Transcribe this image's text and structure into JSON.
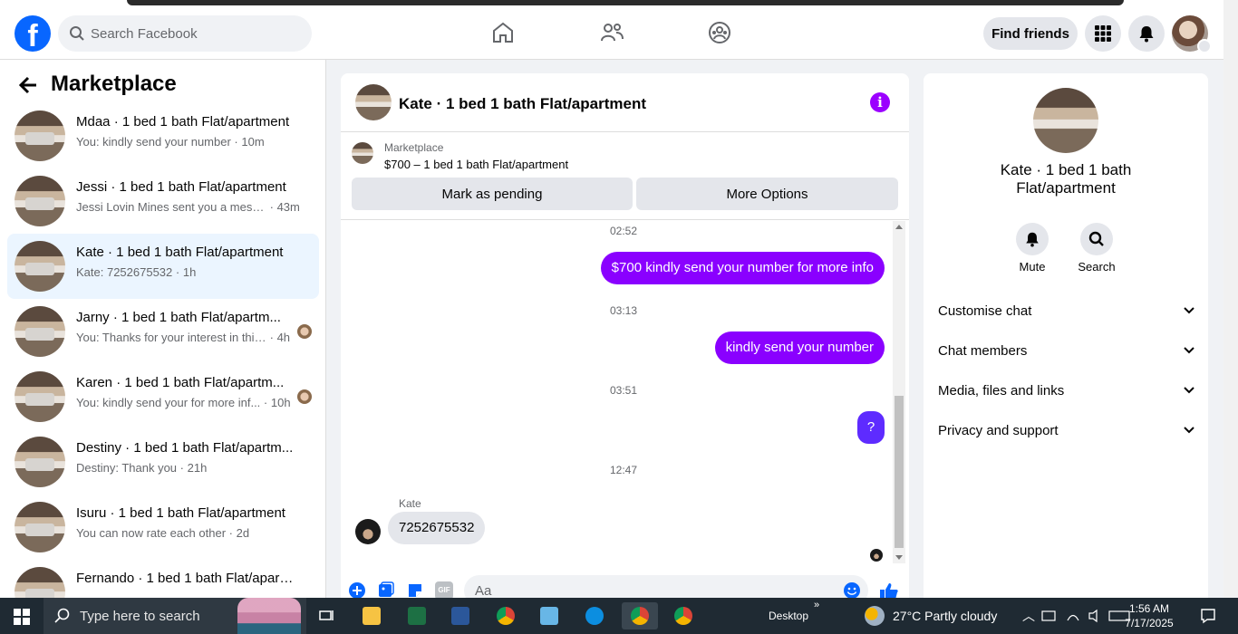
{
  "header": {
    "logo": "f",
    "search_placeholder": "Search Facebook",
    "find_friends_label": "Find friends",
    "nav_icons": [
      "home-icon",
      "friends-icon",
      "groups-icon"
    ],
    "right_icons": [
      "menu-grid-icon",
      "bell-icon",
      "profile-avatar"
    ]
  },
  "sidebar": {
    "title": "Marketplace",
    "conversations": [
      {
        "title": "Mdaa · 1 bed 1 bath Flat/apartment",
        "preview": "You: kindly send your number",
        "time": "10m",
        "active": false
      },
      {
        "title": "Jessi · 1 bed 1 bath Flat/apartment",
        "preview": "Jessi Lovin Mines sent you a messag...",
        "time": "43m",
        "active": false
      },
      {
        "title": "Kate · 1 bed 1 bath Flat/apartment",
        "preview": "Kate: 7252675532",
        "time": "1h",
        "active": true
      },
      {
        "title": "Jarny · 1 bed 1 bath Flat/apartm...",
        "preview": "You: Thanks for your interest in this...",
        "time": "4h",
        "active": false
      },
      {
        "title": "Karen · 1 bed 1 bath Flat/apartm...",
        "preview": "You: kindly send your for more inf...",
        "time": "10h",
        "active": false
      },
      {
        "title": "Destiny · 1 bed 1 bath Flat/apartm...",
        "preview": "Destiny: Thank you",
        "time": "21h",
        "active": false
      },
      {
        "title": "Isuru · 1 bed 1 bath Flat/apartment",
        "preview": "You can now rate each other",
        "time": "2d",
        "active": false
      },
      {
        "title": "Fernando · 1 bed 1 bath Flat/apart...",
        "preview": "",
        "time": "",
        "active": false
      }
    ]
  },
  "chat": {
    "title": "Kate · 1 bed 1 bath Flat/apartment",
    "info_icon": "i",
    "marketplace_label": "Marketplace",
    "listing": "$700 – 1 bed 1 bath Flat/apartment",
    "mark_pending_label": "Mark as pending",
    "more_options_label": "More Options",
    "messages": {
      "t1": "02:52",
      "m1": "$700 kindly send your number for more info",
      "t2": "03:13",
      "m2": "kindly send your number",
      "t3": "03:51",
      "m3": "?",
      "t4": "12:47",
      "sender": "Kate",
      "m4": "7252675532"
    },
    "composer_placeholder": "Aa",
    "composer_gif": "GIF"
  },
  "details": {
    "name": "Kate · 1 bed 1 bath Flat/apartment",
    "mute_label": "Mute",
    "search_label": "Search",
    "sections": [
      "Customise chat",
      "Chat members",
      "Media, files and links",
      "Privacy and support"
    ]
  },
  "taskbar": {
    "search_placeholder": "Type here to search",
    "desktop_label": "Desktop",
    "weather": "27°C  Partly cloudy",
    "time": "1:56 AM",
    "date": "7/17/2025",
    "colors": {
      "excel": "#1d7044",
      "word": "#2b579a",
      "files": "#f6c343",
      "edge": "#0c8ee0"
    }
  }
}
